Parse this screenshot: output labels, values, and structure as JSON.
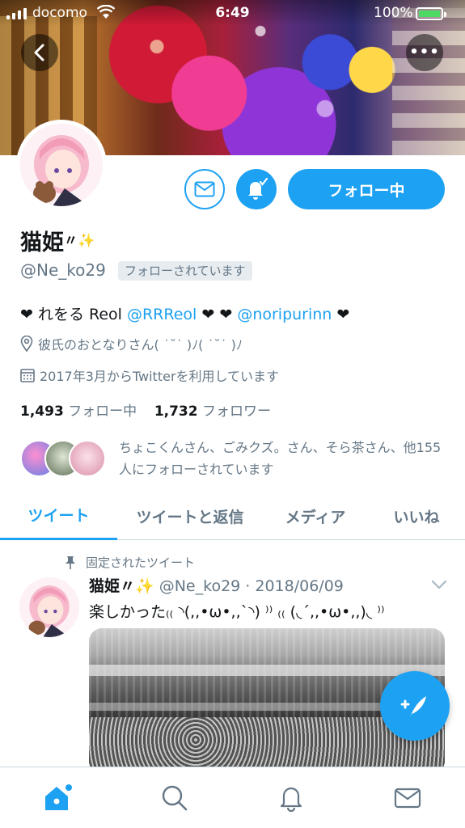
{
  "status_bar": {
    "carrier": "docomo",
    "time": "6:49",
    "battery": "100%"
  },
  "profile": {
    "display_name": "猫姫",
    "name_decoration": "〃✨",
    "handle": "@Ne_ko29",
    "follows_you": "フォローされています",
    "follow_button": "フォロー中",
    "bio": {
      "prefix": "❤ れをる Reol ",
      "mention1": "@RRReol",
      "middle": " ❤ ❤ ",
      "mention2": "@noripurinn",
      "suffix": " ❤"
    },
    "location": "彼氏のおとなりさん( ˙˘˙ )ﾉ( ˙˘˙ )ﾉ",
    "joined": "2017年3月からTwitterを利用しています",
    "following_count": "1,493",
    "following_label": "フォロー中",
    "followers_count": "1,732",
    "followers_label": "フォロワー",
    "followed_by": "ちょこくんさん、ごみクズ。さん、そら茶さん、他155人にフォローされています"
  },
  "tabs": [
    {
      "label": "ツイート",
      "active": true
    },
    {
      "label": "ツイートと返信",
      "active": false
    },
    {
      "label": "メディア",
      "active": false
    },
    {
      "label": "いいね",
      "active": false
    }
  ],
  "pinned_tweet": {
    "pinned_label": "固定されたツイート",
    "name": "猫姫〃✨",
    "handle_date": "@Ne_ko29 · 2018/06/09",
    "text": "楽しかった₍₍ ◝(,,•ω•,,`◝) ⁾⁾ ₍₍ (◟´,,•ω•,,)◟ ⁾⁾"
  },
  "colors": {
    "accent": "#1da1f2",
    "text": "#14171a",
    "secondary": "#657786",
    "border": "#ccd6dd"
  },
  "icons": {
    "back": "chevron-left-icon",
    "more": "more-icon",
    "message": "mail-icon",
    "notify": "bell-check-icon",
    "location": "location-pin-icon",
    "calendar": "calendar-icon",
    "pin": "pin-icon",
    "compose": "compose-feather-icon",
    "home": "home-icon",
    "search": "search-icon",
    "notifications": "bell-icon",
    "dm": "mail-icon"
  }
}
